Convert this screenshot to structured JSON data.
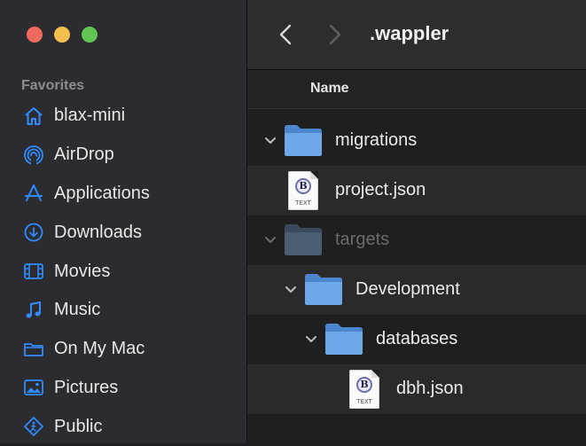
{
  "sidebar": {
    "section_label": "Favorites",
    "items": [
      {
        "label": "blax-mini",
        "icon": "home-icon"
      },
      {
        "label": "AirDrop",
        "icon": "airdrop-icon"
      },
      {
        "label": "Applications",
        "icon": "applications-icon"
      },
      {
        "label": "Downloads",
        "icon": "downloads-icon"
      },
      {
        "label": "Movies",
        "icon": "movies-icon"
      },
      {
        "label": "Music",
        "icon": "music-icon"
      },
      {
        "label": "On My Mac",
        "icon": "folder-icon"
      },
      {
        "label": "Pictures",
        "icon": "pictures-icon"
      },
      {
        "label": "Public",
        "icon": "public-icon"
      }
    ]
  },
  "toolbar": {
    "title": ".wappler"
  },
  "list": {
    "column_name": "Name",
    "rows": [
      {
        "name": "migrations",
        "kind": "folder",
        "depth": 0,
        "expanded": true
      },
      {
        "name": "project.json",
        "kind": "file",
        "depth": 0,
        "file_type": "TEXT"
      },
      {
        "name": "targets",
        "kind": "folder",
        "depth": 0,
        "expanded": true,
        "dimmed": true
      },
      {
        "name": "Development",
        "kind": "folder",
        "depth": 1,
        "expanded": true
      },
      {
        "name": "databases",
        "kind": "folder",
        "depth": 2,
        "expanded": true
      },
      {
        "name": "dbh.json",
        "kind": "file",
        "depth": 3,
        "file_type": "TEXT"
      }
    ]
  },
  "colors": {
    "accent": "#2f8cff",
    "folder": "#6fa8e8"
  }
}
